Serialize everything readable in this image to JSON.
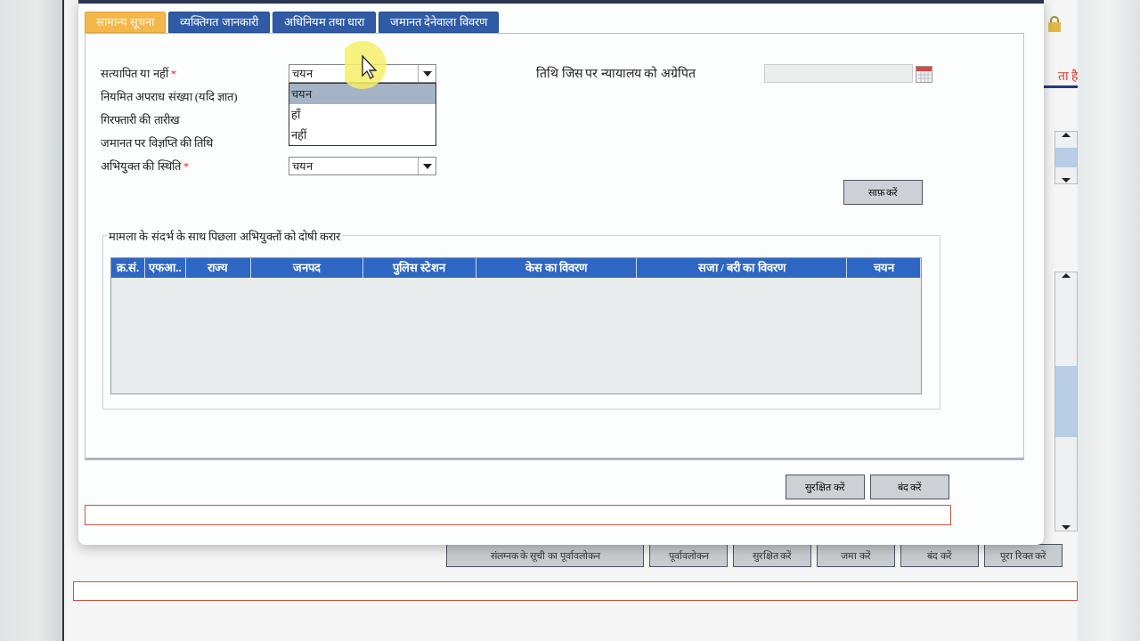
{
  "dialog": {
    "tabs": [
      {
        "label": "सामान्य सूचना",
        "selected": true
      },
      {
        "label": "व्यक्तिगत जानकारी",
        "selected": false
      },
      {
        "label": "अधिनियम तथा धारा",
        "selected": false
      },
      {
        "label": "जमानत देनेवाला विवरण",
        "selected": false
      }
    ],
    "fields": [
      {
        "label": "सत्यापित या नहीं",
        "required_mark": "*",
        "kind": "select",
        "value": "चयन",
        "open": true,
        "options": [
          {
            "label": "चयन",
            "selected": true
          },
          {
            "label": "हाँ",
            "selected": false
          },
          {
            "label": "नहीं",
            "selected": false
          }
        ]
      },
      {
        "label": "नियमित  अपराध संख्या (यदि ज्ञात)",
        "kind": "label"
      },
      {
        "label": "गिरफ्तारी की तारीख",
        "kind": "label"
      },
      {
        "label": "जमानत पर विज्ञप्ति की तिथि",
        "kind": "label"
      },
      {
        "label": "अभियुक्त की स्थिति",
        "required_mark": "*",
        "kind": "select",
        "value": "चयन",
        "open": false
      }
    ],
    "date_field": {
      "label": "तिथि  जिस पर न्यायालय को अग्रेपित",
      "disabled": true
    },
    "clear_button": "साफ़ करें",
    "history": {
      "title": "मामला के संदर्भ के साथ पिछला अभियुक्तों को दोषी करार",
      "columns": [
        "क्र.सं.",
        "एफआ..",
        "राज्य",
        "जनपद",
        "पुलिस स्टेशन",
        "केस का विवरण",
        "सजा / बरी का विवरण",
        "चयन"
      ]
    },
    "buttons": [
      "सुरक्षित करें",
      "बंद करें"
    ]
  },
  "background": {
    "side_text": "ता है",
    "buttons": [
      "संलग्नक के सूची का पूर्वावलोकन",
      "पूर्वावलोकन",
      "सुरक्षित करें",
      "जमा करें",
      "बंद करें",
      "पूरा रिक्त करें"
    ]
  }
}
